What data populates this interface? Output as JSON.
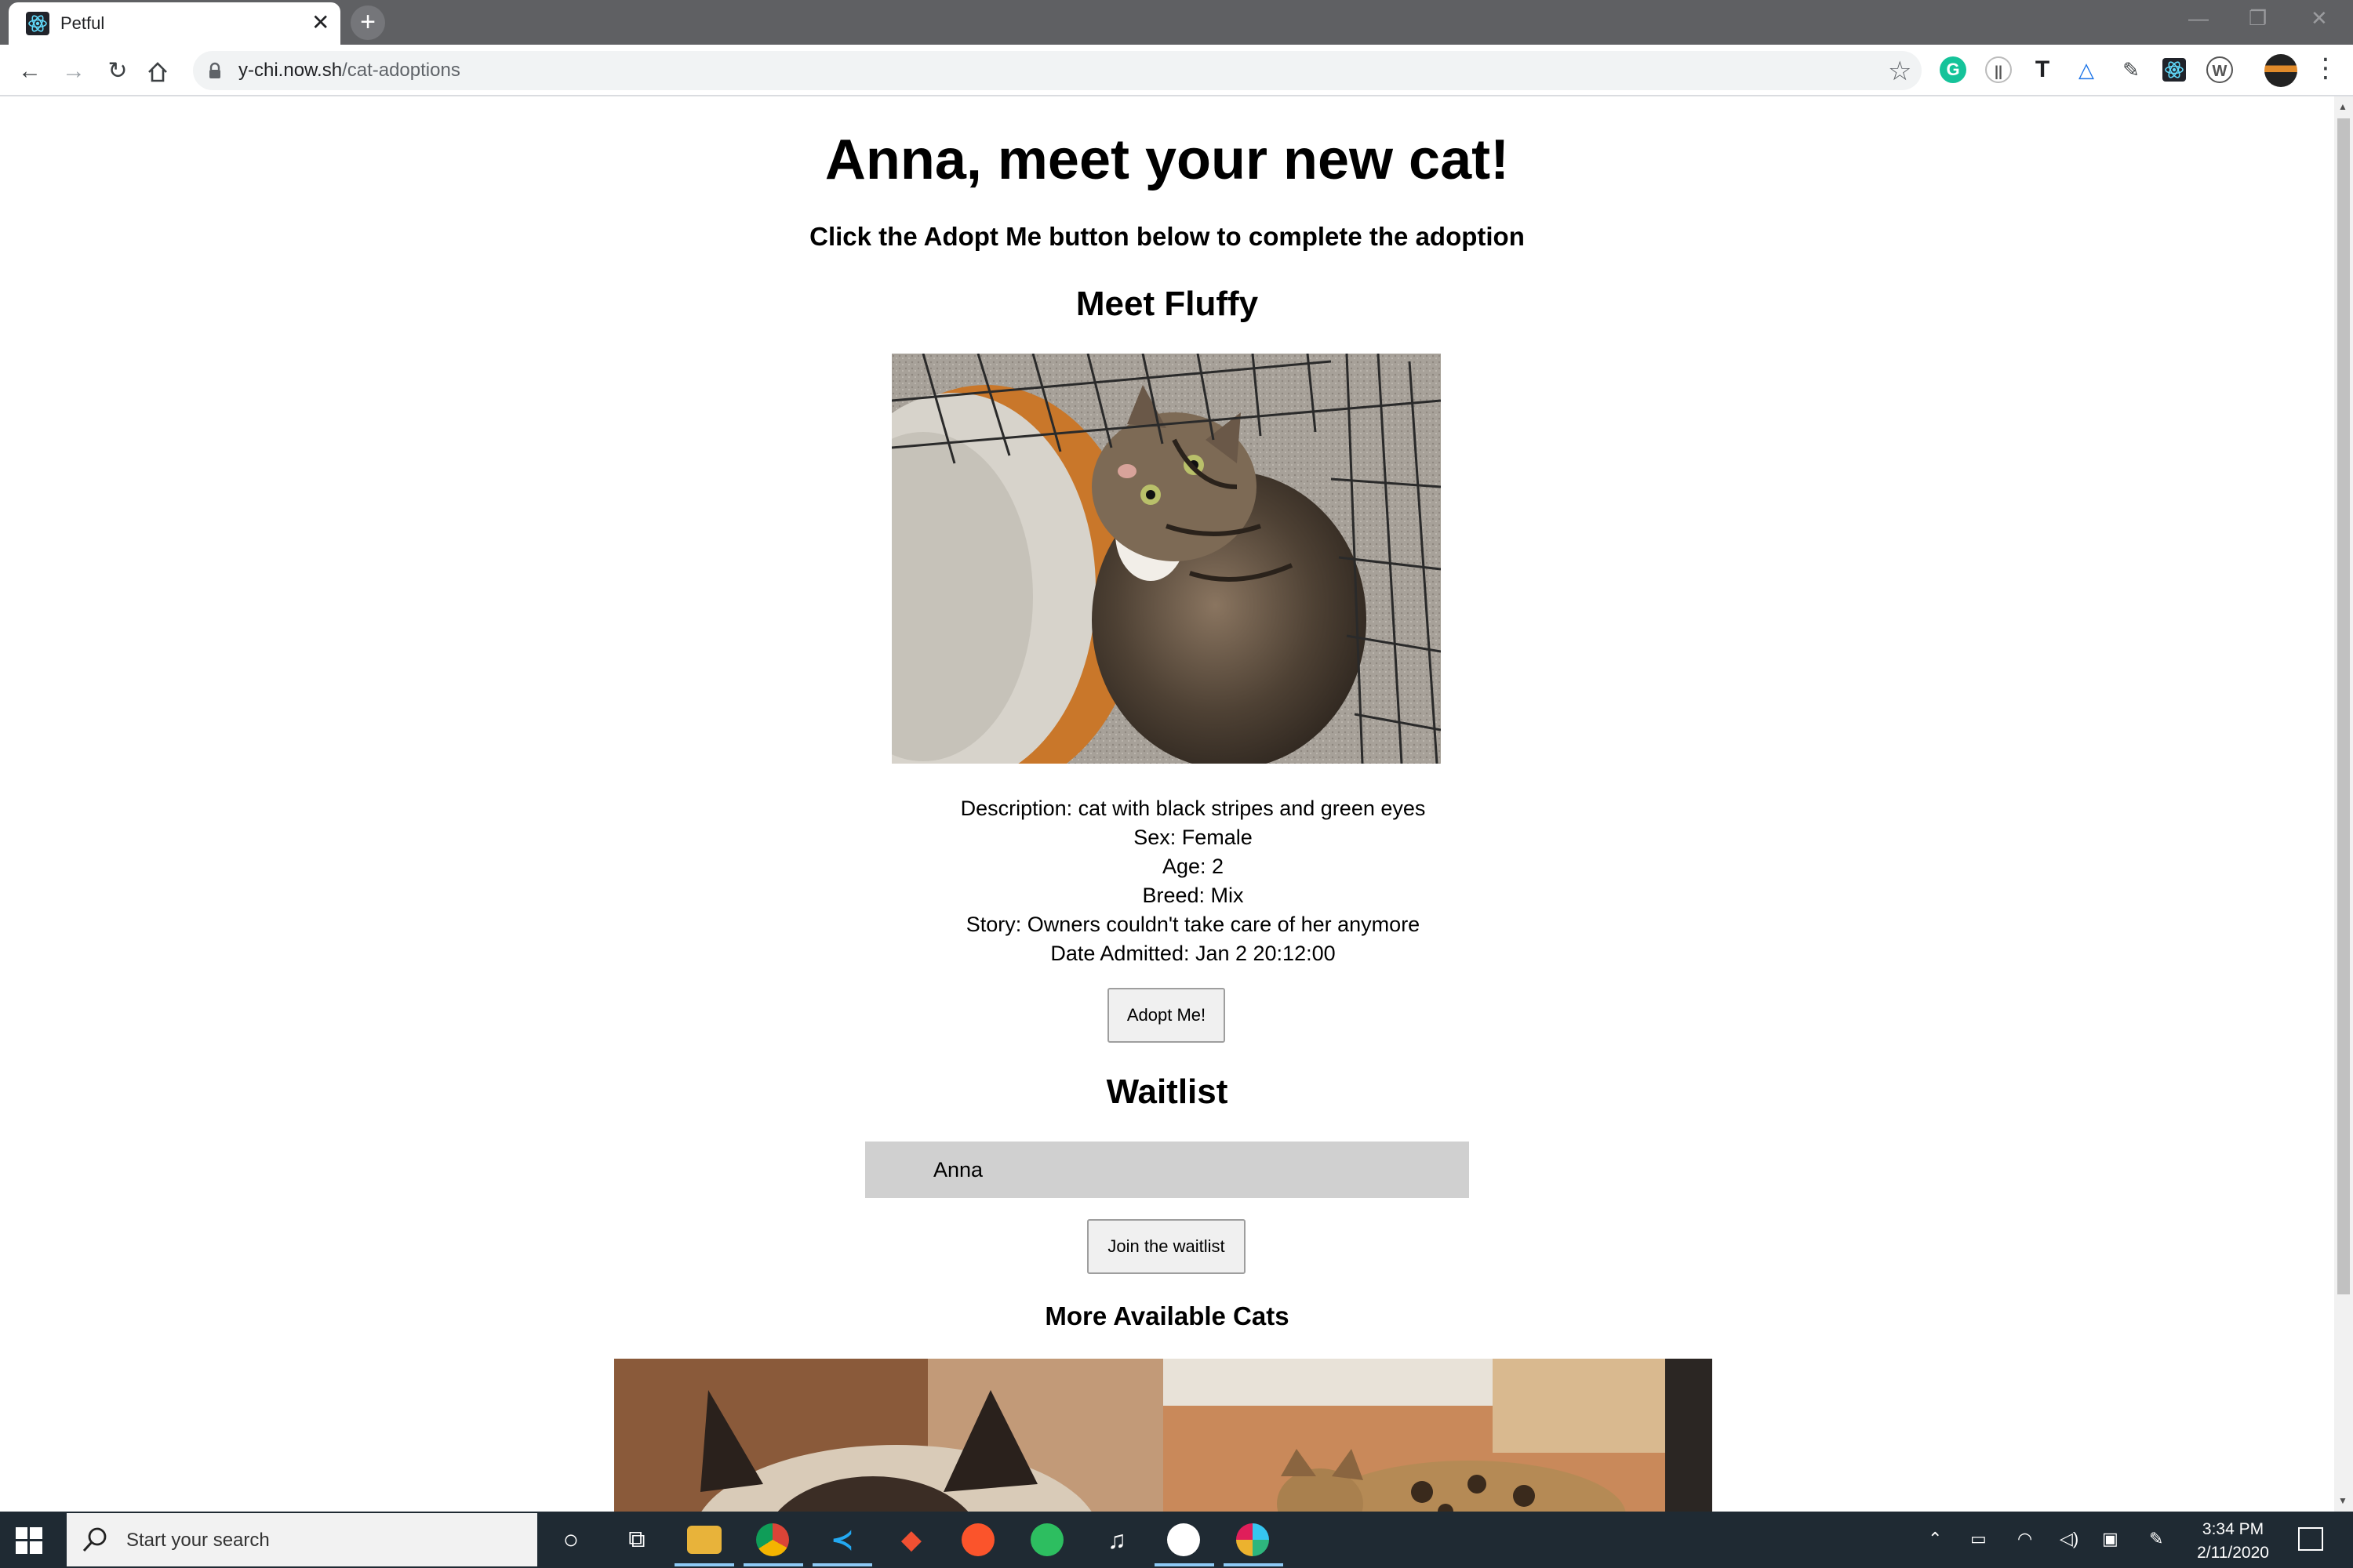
{
  "browser": {
    "tab_title": "Petful",
    "tab_close": "✕",
    "new_tab": "+",
    "url_host": "y-chi.now.sh",
    "url_path": "/cat-adoptions"
  },
  "page": {
    "heading": "Anna, meet your new cat!",
    "instruction": "Click the Adopt Me button below to complete the adoption",
    "pet_heading": "Meet Fluffy",
    "details": [
      "Description: cat with black stripes and green eyes",
      "Sex: Female",
      "Age: 2",
      "Breed: Mix",
      "Story: Owners couldn't take care of her anymore",
      "Date Admitted: Jan 2 20:12:00"
    ],
    "adopt_button": "Adopt Me!",
    "waitlist_heading": "Waitlist",
    "waitlist_names": [
      "Anna"
    ],
    "join_button": "Join the waitlist",
    "more_heading": "More Available Cats"
  },
  "taskbar": {
    "search_placeholder": "Start your search",
    "time": "3:34 PM",
    "date": "2/11/2020"
  },
  "icons": {
    "tab": "react-logo-icon",
    "toolbar": [
      "back-icon",
      "forward-icon",
      "reload-icon",
      "home-icon",
      "lock-icon",
      "bookmark-star-icon",
      "menu-kebab-icon"
    ],
    "extensions": [
      "grammarly-icon",
      "extension-bars-icon",
      "text-tool-icon",
      "triangle-extension-icon",
      "pen-extension-icon",
      "react-devtools-icon",
      "wordpress-icon"
    ],
    "taskbar": [
      "windows-start-icon",
      "search-icon",
      "cortana-icon",
      "task-view-icon",
      "file-explorer-icon",
      "chrome-icon",
      "vscode-icon",
      "git-icon",
      "brave-icon",
      "evernote-icon",
      "music-icon",
      "github-desktop-icon",
      "slack-icon"
    ]
  },
  "colors": {
    "tabstrip": "#5f6063",
    "omnibox": "#f1f3f4",
    "waitlist_bg": "#d0d0d0",
    "taskbar": "#1f2a33"
  }
}
